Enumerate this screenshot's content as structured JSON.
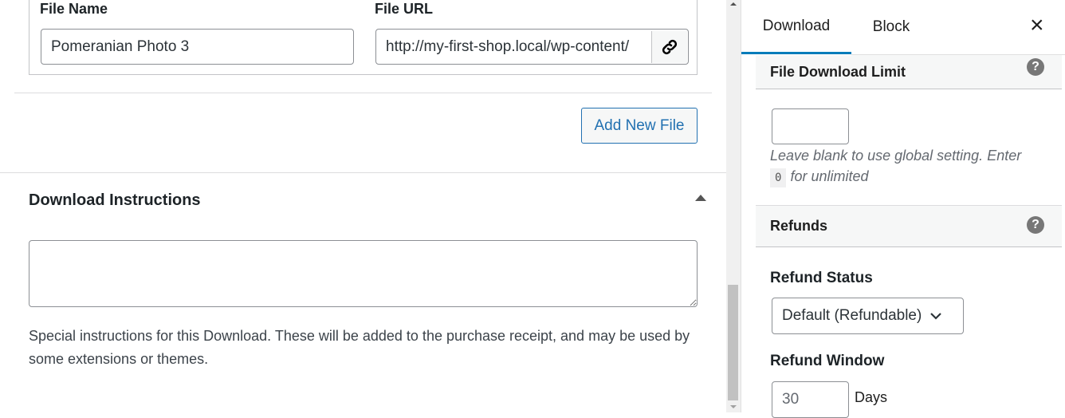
{
  "files": {
    "file_name_label": "File Name",
    "file_url_label": "File URL",
    "file_name_value": "Pomeranian Photo 3",
    "file_url_value": "http://my-first-shop.local/wp-content/",
    "add_new_file": "Add New File"
  },
  "instructions": {
    "title": "Download Instructions",
    "value": "",
    "help": "Special instructions for this Download. These will be added to the purchase receipt, and may be used by some extensions or themes."
  },
  "sidebar": {
    "tabs": [
      {
        "label": "Download",
        "active": true
      },
      {
        "label": "Block",
        "active": false
      }
    ],
    "close": "×",
    "download_limit": {
      "title": "File Download Limit",
      "value": "",
      "help_before": "Leave blank to use global setting. Enter",
      "help_code": "0",
      "help_after": "for unlimited"
    },
    "refunds": {
      "title": "Refunds",
      "status_label": "Refund Status",
      "status_value": "Default (Refundable)",
      "window_label": "Refund Window",
      "window_value": "30",
      "window_unit": "Days"
    }
  },
  "colors": {
    "accent": "#007cba",
    "link_button": "#2271b1"
  }
}
